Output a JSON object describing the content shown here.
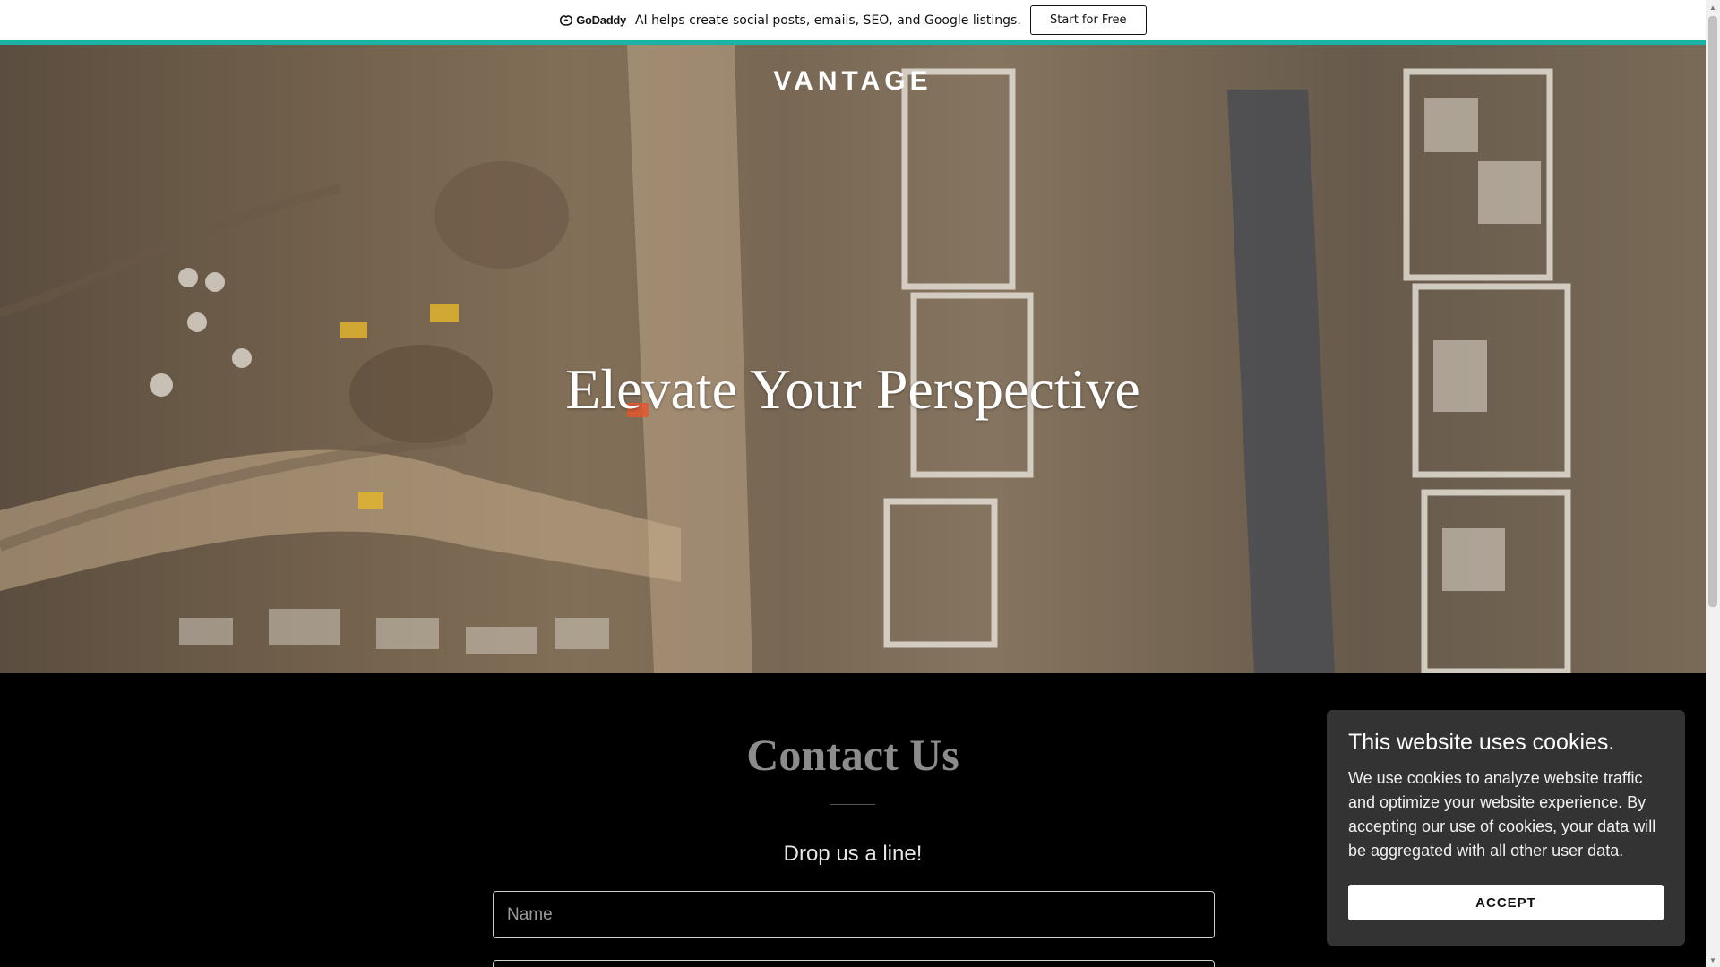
{
  "promo": {
    "logo_text": "GoDaddy",
    "message": "AI helps create social posts, emails, SEO, and Google listings.",
    "cta_label": "Start for Free",
    "accent_color": "#1bb1a5"
  },
  "hero": {
    "site_title": "VANTAGE",
    "heading": "Elevate Your Perspective"
  },
  "contact": {
    "title": "Contact Us",
    "subtitle": "Drop us a line!",
    "name_placeholder": "Name",
    "email_placeholder": ""
  },
  "cookie_banner": {
    "title": "This website uses cookies.",
    "body": "We use cookies to analyze website traffic and optimize your website experience. By accepting our use of cookies, your data will be aggregated with all other user data.",
    "accept_label": "ACCEPT"
  },
  "icons": {
    "gd_logo": "godaddy-logo-icon",
    "scroll_up": "scroll-up-arrow-icon",
    "scroll_down": "scroll-down-arrow-icon"
  }
}
